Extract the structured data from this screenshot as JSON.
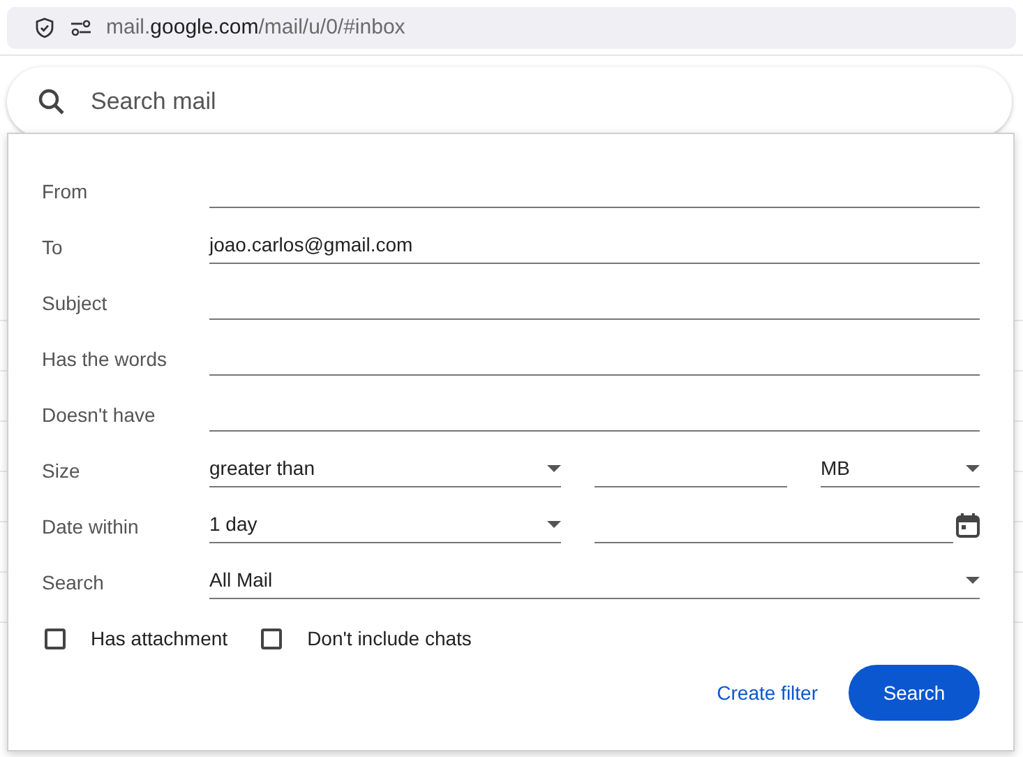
{
  "address_bar": {
    "prefix": "mail.",
    "domain": "google.com",
    "path": "/mail/u/0/#inbox"
  },
  "search": {
    "placeholder": "Search mail"
  },
  "advanced_search": {
    "rows": [
      {
        "kind": "text",
        "label": "From"
      },
      {
        "kind": "text",
        "label": "To",
        "value": "joao.carlos@gmail.com"
      },
      {
        "kind": "text",
        "label": "Subject"
      },
      {
        "kind": "text",
        "label": "Has the words"
      },
      {
        "kind": "text",
        "label": "Doesn't have"
      },
      {
        "kind": "size",
        "label": "Size",
        "operator": "greater than",
        "unit": "MB"
      },
      {
        "kind": "date",
        "label": "Date within",
        "range": "1 day"
      },
      {
        "kind": "select",
        "label": "Search",
        "value": "All Mail"
      }
    ],
    "checkboxes": [
      {
        "label": "Has attachment",
        "checked": false
      },
      {
        "label": "Don't include chats",
        "checked": false
      }
    ],
    "buttons": {
      "create_filter": "Create filter",
      "search": "Search"
    }
  }
}
